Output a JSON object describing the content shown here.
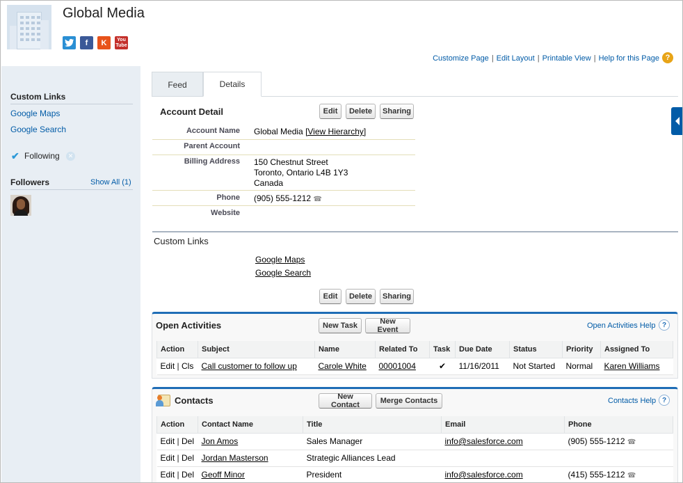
{
  "header": {
    "account_name": "Global Media",
    "social": [
      "twitter-icon",
      "facebook-icon",
      "klout-icon",
      "youtube-icon"
    ]
  },
  "top_links": [
    "Customize Page",
    "Edit Layout",
    "Printable View",
    "Help for this Page"
  ],
  "sidebar": {
    "custom_links_title": "Custom Links",
    "links": [
      "Google Maps",
      "Google Search"
    ],
    "following_label": "Following",
    "followers_title": "Followers",
    "show_all": "Show All (1)"
  },
  "tabs": [
    "Feed",
    "Details"
  ],
  "account_detail": {
    "title": "Account Detail",
    "buttons": [
      "Edit",
      "Delete",
      "Sharing"
    ],
    "fields": {
      "account_name_label": "Account Name",
      "account_name_value": "Global Media",
      "view_hierarchy": "[View Hierarchy]",
      "parent_account_label": "Parent Account",
      "billing_address_label": "Billing Address",
      "billing_line1": "150 Chestnut Street",
      "billing_line2": "Toronto, Ontario L4B 1Y3",
      "billing_line3": "Canada",
      "phone_label": "Phone",
      "phone_value": "(905) 555-1212",
      "website_label": "Website"
    }
  },
  "custom_links_section": {
    "title": "Custom Links",
    "links": [
      "Google Maps",
      "Google Search"
    ],
    "buttons": [
      "Edit",
      "Delete",
      "Sharing"
    ]
  },
  "open_activities": {
    "title": "Open Activities",
    "buttons": [
      "New Task",
      "New Event"
    ],
    "help": "Open Activities Help",
    "columns": [
      "Action",
      "Subject",
      "Name",
      "Related To",
      "Task",
      "Due Date",
      "Status",
      "Priority",
      "Assigned To"
    ],
    "rows": [
      {
        "edit": "Edit",
        "sep": "|",
        "cls": "Cls",
        "subject": "Call customer to follow up",
        "name": "Carole White",
        "related": "00001004",
        "task": "✔",
        "due": "11/16/2011",
        "status": "Not Started",
        "priority": "Normal",
        "assigned": "Karen Williams"
      }
    ]
  },
  "contacts": {
    "title": "Contacts",
    "buttons": [
      "New Contact",
      "Merge Contacts"
    ],
    "help": "Contacts Help",
    "columns": [
      "Action",
      "Contact Name",
      "Title",
      "Email",
      "Phone"
    ],
    "rows": [
      {
        "edit": "Edit",
        "sep": "|",
        "del": "Del",
        "name": "Jon Amos",
        "title": "Sales Manager",
        "email": "info@salesforce.com",
        "phone": "(905) 555-1212"
      },
      {
        "edit": "Edit",
        "sep": "|",
        "del": "Del",
        "name": "Jordan Masterson",
        "title": "Strategic Alliances Lead",
        "email": "",
        "phone": ""
      },
      {
        "edit": "Edit",
        "sep": "|",
        "del": "Del",
        "name": "Geoff Minor",
        "title": "President",
        "email": "info@salesforce.com",
        "phone": "(415) 555-1212"
      }
    ]
  },
  "colors": {
    "link": "#015ba7",
    "section_accent": "#1f6db6",
    "sidebar_bg": "#e8eef4"
  }
}
